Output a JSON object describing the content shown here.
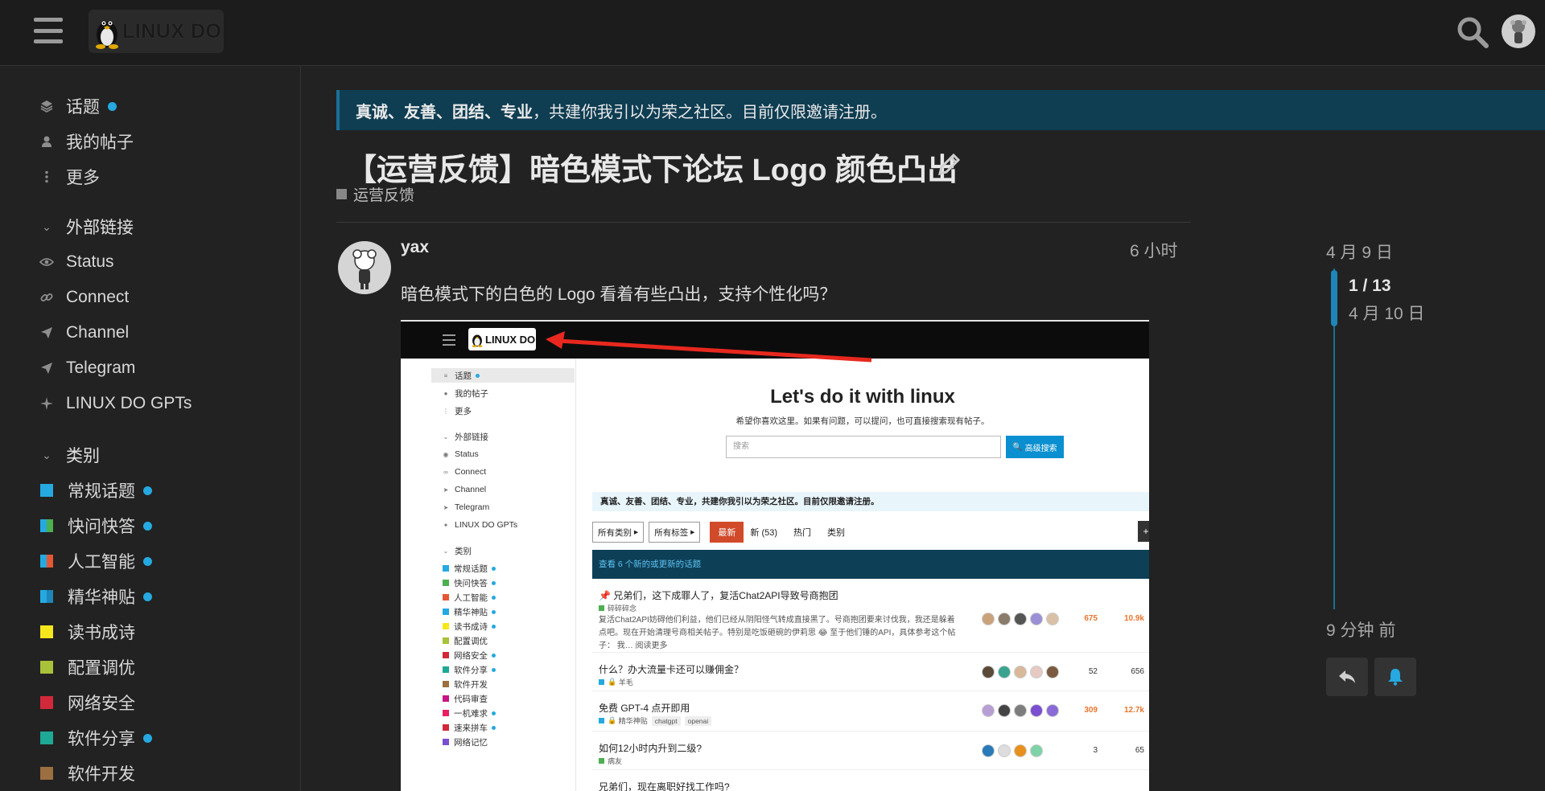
{
  "header": {
    "logo_text": "LINUX DO"
  },
  "sidebar": {
    "items": [
      {
        "label": "话题",
        "icon": "layers-icon",
        "dot": true
      },
      {
        "label": "我的帖子",
        "icon": "user-icon"
      },
      {
        "label": "更多",
        "icon": "more-vertical-icon"
      }
    ],
    "links_section": "外部链接",
    "links": [
      {
        "label": "Status",
        "icon": "eye-icon"
      },
      {
        "label": "Connect",
        "icon": "link-icon"
      },
      {
        "label": "Channel",
        "icon": "paper-plane-icon"
      },
      {
        "label": "Telegram",
        "icon": "paper-plane-icon"
      },
      {
        "label": "LINUX DO GPTs",
        "icon": "sparkle-icon"
      }
    ],
    "categories_section": "类别",
    "categories": [
      {
        "label": "常规话题",
        "color": "#25a9e0",
        "dot": true
      },
      {
        "label": "快问快答",
        "color": "#4caf50",
        "dot": true
      },
      {
        "label": "人工智能",
        "color": "#e45735",
        "dot": true
      },
      {
        "label": "精华神贴",
        "color": "#25a9e0",
        "dot": true
      },
      {
        "label": "读书成诗",
        "color": "#f5e71b",
        "dot": false
      },
      {
        "label": "配置调优",
        "color": "#a8c23a",
        "dot": false
      },
      {
        "label": "网络安全",
        "color": "#d1293a",
        "dot": false
      },
      {
        "label": "软件分享",
        "color": "#1ea896",
        "dot": true
      },
      {
        "label": "软件开发",
        "color": "#9b6f3f",
        "dot": false
      }
    ]
  },
  "banner": {
    "bold": "真诚、友善、团结、专业",
    "rest": "，共建你我引以为荣之社区。目前仅限邀请注册。"
  },
  "topic": {
    "title": "【运营反馈】暗色模式下论坛 Logo 颜色凸出",
    "category": "运营反馈"
  },
  "post": {
    "username": "yax",
    "time": "6 小时",
    "body": "暗色模式下的白色的 Logo 看着有些凸出，支持个性化吗？"
  },
  "screenshot": {
    "logo_text": "LINUX DO",
    "side_items": [
      {
        "label": "话题",
        "dot": true
      },
      {
        "label": "我的帖子"
      },
      {
        "label": "更多"
      }
    ],
    "links_section": "外部链接",
    "links": [
      "Status",
      "Connect",
      "Channel",
      "Telegram",
      "LINUX DO GPTs"
    ],
    "categories_section": "类别",
    "categories": [
      {
        "label": "常规话题",
        "color": "#25a9e0",
        "dot": true
      },
      {
        "label": "快问快答",
        "color": "#4caf50",
        "dot": true
      },
      {
        "label": "人工智能",
        "color": "#e45735",
        "dot": true
      },
      {
        "label": "精华神贴",
        "color": "#25a9e0",
        "dot": true
      },
      {
        "label": "读书成诗",
        "color": "#f5e71b",
        "dot": true
      },
      {
        "label": "配置调优",
        "color": "#a8c23a",
        "dot": false
      },
      {
        "label": "网络安全",
        "color": "#d1293a",
        "dot": true
      },
      {
        "label": "软件分享",
        "color": "#1ea896",
        "dot": true
      },
      {
        "label": "软件开发",
        "color": "#9b6f3f",
        "dot": false
      },
      {
        "label": "代码审查",
        "color": "#c71585",
        "dot": false
      },
      {
        "label": "一机难求",
        "color": "#e91e63",
        "dot": true
      },
      {
        "label": "速来拼车",
        "color": "#d1293a",
        "dot": true
      },
      {
        "label": "网络记忆",
        "color": "#7b4fd1",
        "dot": false
      }
    ],
    "hero_title": "Let's do it with linux",
    "hero_sub": "希望你喜欢这里。如果有问题，可以提问，也可直接搜索现有帖子。",
    "search_placeholder": "搜索",
    "adv_search": "高级搜索",
    "banner": "真诚、友善、团结、专业，共建你我引以为荣之社区。目前仅限邀请注册。",
    "nav": {
      "all_categories": "所有类别",
      "all_tags": "所有标签",
      "latest": "最新",
      "new": "新 (53)",
      "hot": "热门",
      "categories": "类别"
    },
    "new_topics": "查看 6 个新的或更新的话题",
    "topics": [
      {
        "title": "兄弟们，这下成罪人了，复活Chat2API导致号商抱团",
        "category": "碎碎碎念",
        "cat_color": "#4caf50",
        "excerpt": "复活Chat2API妨碍他们利益，他们已经从阴阳怪气转成直接黑了。号商抱团要来讨伐我，我还是躲着点吧。现在开始清理号商相关帖子。特别是吃饭砸碗的伊莉思 😂 至于他们锤的API，具体参考这个帖子： 我… 阅读更多",
        "replies": "675",
        "views": "10.9k",
        "hot": true
      },
      {
        "title": "什么？办大流量卡还可以赚佣金？",
        "category": "羊毛",
        "cat_color": "#25a9e0",
        "replies": "52",
        "views": "656",
        "hot": false
      },
      {
        "title": "免费 GPT-4 点开即用",
        "category": "精华神贴",
        "cat_color": "#25a9e0",
        "tags": [
          "chatgpt",
          "openai"
        ],
        "replies": "309",
        "views": "12.7k",
        "hot": true
      },
      {
        "title": "如何12小时内升到二级?",
        "category": "病友",
        "cat_color": "#4caf50",
        "replies": "3",
        "views": "65",
        "hot": false
      },
      {
        "title": "兄弟们，现在离职好找工作吗?",
        "category": "",
        "replies": "",
        "views": "",
        "hot": false
      }
    ]
  },
  "timeline": {
    "date_top": "4 月 9 日",
    "count": "1 / 13",
    "date_current": "4 月 10 日",
    "ago": "9 分钟 前"
  }
}
